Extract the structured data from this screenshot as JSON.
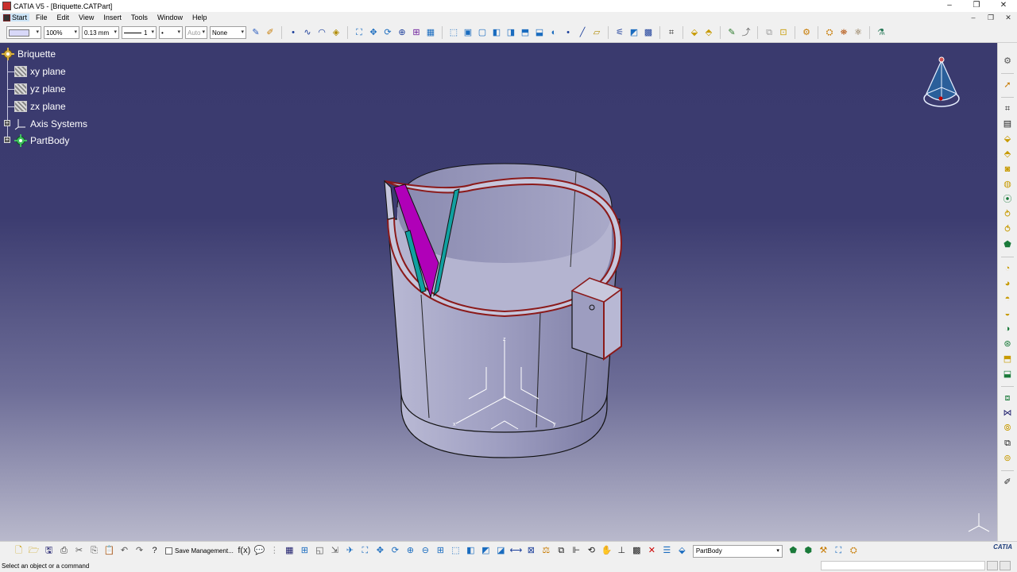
{
  "window": {
    "title": "CATIA V5 - [Briquette.CATPart]",
    "controls": [
      "–",
      "❐",
      "✕"
    ]
  },
  "menubar": {
    "items": [
      "Start",
      "File",
      "Edit",
      "View",
      "Insert",
      "Tools",
      "Window",
      "Help"
    ],
    "controls": [
      "–",
      "❐",
      "✕"
    ]
  },
  "toolbar": {
    "transparency": "100%",
    "thickness": "0.13 mm",
    "linetype": "1",
    "point": "•",
    "layer_auto": "Auto",
    "layer": "None"
  },
  "spec_tree": {
    "root": "Briquette",
    "items": [
      {
        "label": "xy plane",
        "icon": "plane-icon"
      },
      {
        "label": "yz plane",
        "icon": "plane-icon"
      },
      {
        "label": "zx plane",
        "icon": "plane-icon"
      },
      {
        "label": "Axis Systems",
        "icon": "axis-system-icon"
      },
      {
        "label": "PartBody",
        "icon": "partbody-icon"
      }
    ]
  },
  "bottom_toolbar": {
    "save_management": "Save Management...",
    "current_body": "PartBody"
  },
  "brand": "CATIA",
  "status": {
    "message": "Select an object or a command"
  },
  "colors": {
    "viewport_top": "#3a3a6e",
    "viewport_bottom": "#b9b9cc",
    "model_surface": "#9d9dc0",
    "model_edge": "#8b1a1a",
    "highlight_magenta": "#b000b8",
    "highlight_teal": "#10a0a0"
  }
}
